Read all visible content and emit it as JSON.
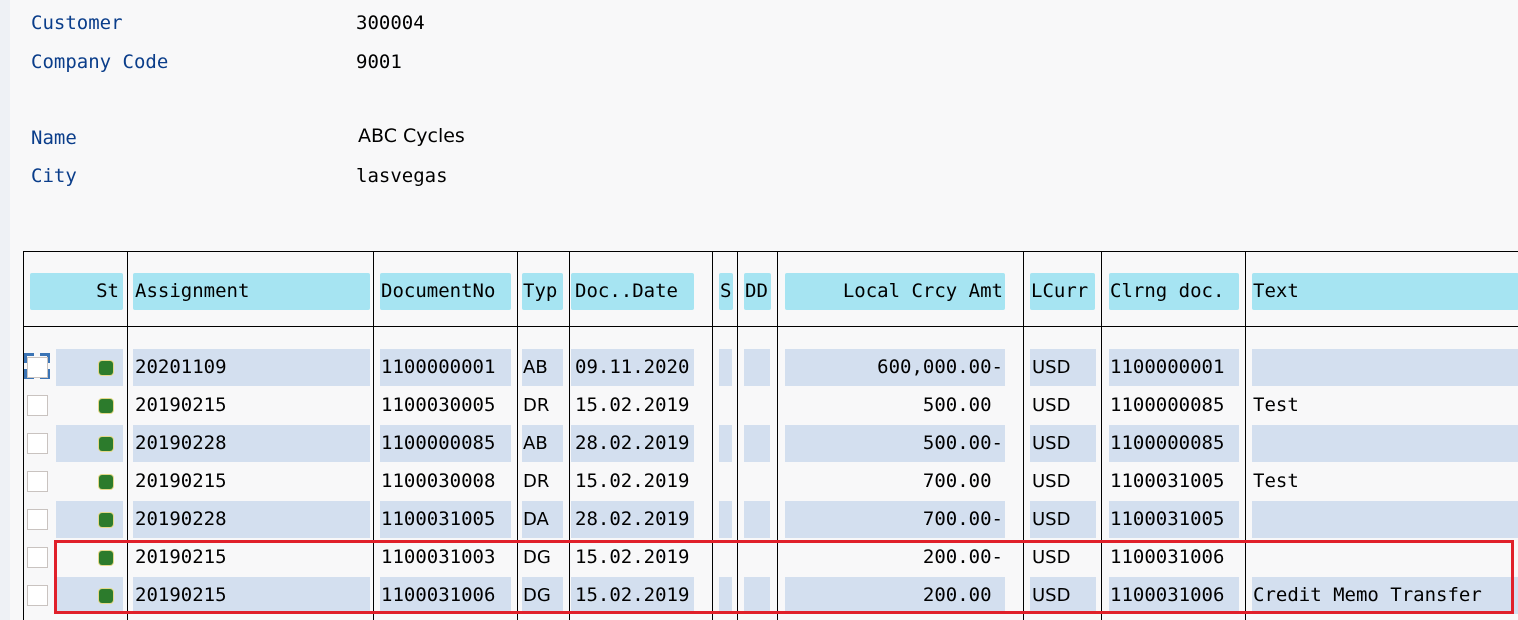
{
  "header": {
    "customer_label": "Customer",
    "customer_value": "300004",
    "company_code_label": "Company Code",
    "company_code_value": "9001",
    "name_label": "Name",
    "name_value": "ABC Cycles",
    "city_label": "City",
    "city_value": "lasvegas"
  },
  "table": {
    "columns": {
      "st": "St",
      "assignment": "Assignment",
      "document_no": "DocumentNo",
      "typ": "Typ",
      "doc_date": "Doc..Date",
      "s": "S",
      "dd": "DD",
      "local_amt": "Local Crcy Amt",
      "lcurr": "LCurr",
      "clrng_doc": "Clrng doc.",
      "text": "Text"
    },
    "rows": [
      {
        "status": "green",
        "assignment": "20201109",
        "document_no": "1100000001",
        "typ": "AB",
        "doc_date": "09.11.2020",
        "s": "",
        "dd": "",
        "local_amt": "600,000.00-",
        "lcurr": "USD",
        "clrng_doc": "1100000001",
        "text": ""
      },
      {
        "status": "green",
        "assignment": "20190215",
        "document_no": "1100030005",
        "typ": "DR",
        "doc_date": "15.02.2019",
        "s": "",
        "dd": "",
        "local_amt": "500.00 ",
        "lcurr": "USD",
        "clrng_doc": "1100000085",
        "text": "Test"
      },
      {
        "status": "green",
        "assignment": "20190228",
        "document_no": "1100000085",
        "typ": "AB",
        "doc_date": "28.02.2019",
        "s": "",
        "dd": "",
        "local_amt": "500.00-",
        "lcurr": "USD",
        "clrng_doc": "1100000085",
        "text": ""
      },
      {
        "status": "green",
        "assignment": "20190215",
        "document_no": "1100030008",
        "typ": "DR",
        "doc_date": "15.02.2019",
        "s": "",
        "dd": "",
        "local_amt": "700.00 ",
        "lcurr": "USD",
        "clrng_doc": "1100031005",
        "text": "Test"
      },
      {
        "status": "green",
        "assignment": "20190228",
        "document_no": "1100031005",
        "typ": "DA",
        "doc_date": "28.02.2019",
        "s": "",
        "dd": "",
        "local_amt": "700.00-",
        "lcurr": "USD",
        "clrng_doc": "1100031005",
        "text": ""
      },
      {
        "status": "green",
        "assignment": "20190215",
        "document_no": "1100031003",
        "typ": "DG",
        "doc_date": "15.02.2019",
        "s": "",
        "dd": "",
        "local_amt": "200.00-",
        "lcurr": "USD",
        "clrng_doc": "1100031006",
        "text": ""
      },
      {
        "status": "green",
        "assignment": "20190215",
        "document_no": "1100031006",
        "typ": "DG",
        "doc_date": "15.02.2019",
        "s": "",
        "dd": "",
        "local_amt": "200.00 ",
        "lcurr": "USD",
        "clrng_doc": "1100031006",
        "text": "Credit Memo Transfer"
      }
    ]
  },
  "colors": {
    "header_cell": "#a6e4f2",
    "row_stripe": "#d3dfef",
    "status_green": "#2c7b2c",
    "label_blue": "#0a3d8a",
    "highlight_red": "#e0202a"
  }
}
